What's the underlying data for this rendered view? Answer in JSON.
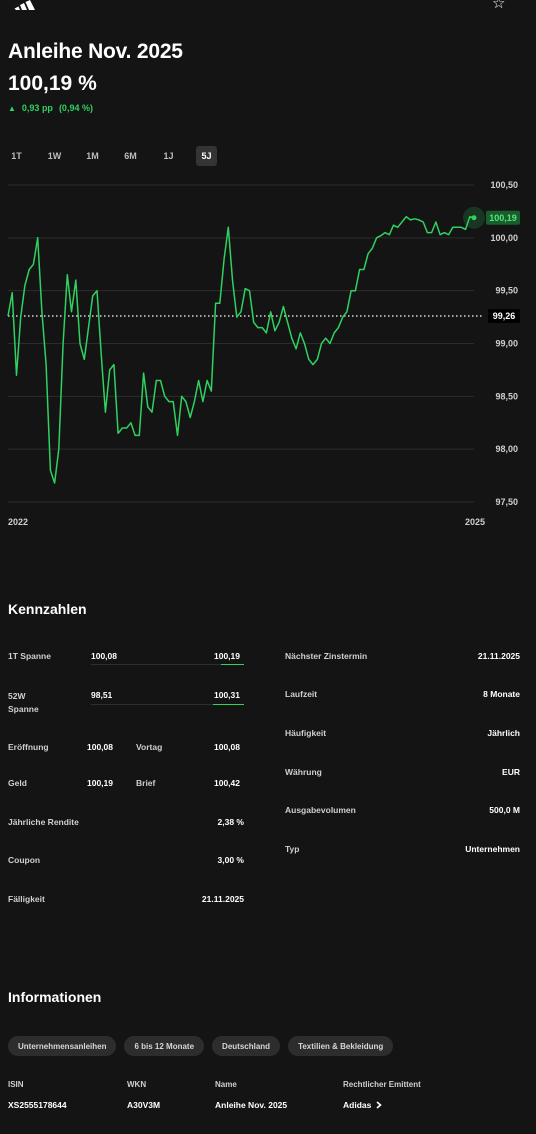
{
  "header": {
    "logo_icon": "adidas-logo-icon",
    "favorite_icon": "star-icon"
  },
  "bond": {
    "title": "Anleihe Nov. 2025",
    "price": "100,19 %",
    "change_abs": "0,93 pp",
    "change_pct": "(0,94 %)",
    "up_color": "#2fd160"
  },
  "ranges": [
    "1T",
    "1W",
    "1M",
    "6M",
    "1J",
    "5J"
  ],
  "active_range": "5J",
  "chart_data": {
    "type": "line",
    "x_start_label": "2022",
    "x_end_label": "2025",
    "y_ticks": [
      "100,50",
      "100,00",
      "99,50",
      "99,00",
      "98,50",
      "98,00",
      "97,50"
    ],
    "ylim": [
      97.5,
      100.5
    ],
    "reference_value": 99.26,
    "reference_label": "99,26",
    "last_label": "100,19",
    "line_color": "#2fd160",
    "values": [
      99.26,
      99.48,
      98.7,
      99.25,
      99.55,
      99.7,
      99.75,
      100.0,
      99.3,
      98.8,
      97.8,
      97.68,
      98.0,
      99.0,
      99.65,
      99.3,
      99.6,
      99.0,
      98.85,
      99.15,
      99.45,
      99.5,
      98.9,
      98.35,
      98.75,
      98.8,
      98.15,
      98.2,
      98.2,
      98.25,
      98.13,
      98.13,
      98.72,
      98.4,
      98.35,
      98.65,
      98.65,
      98.5,
      98.45,
      98.45,
      98.13,
      98.5,
      98.45,
      98.3,
      98.45,
      98.65,
      98.45,
      98.65,
      98.55,
      99.38,
      99.38,
      99.8,
      100.1,
      99.6,
      99.25,
      99.3,
      99.52,
      99.5,
      99.2,
      99.15,
      99.15,
      99.1,
      99.3,
      99.12,
      99.2,
      99.35,
      99.2,
      99.05,
      98.95,
      99.1,
      99.0,
      98.85,
      98.8,
      98.85,
      99.0,
      99.05,
      99.0,
      99.1,
      99.15,
      99.25,
      99.3,
      99.5,
      99.5,
      99.7,
      99.7,
      99.85,
      99.9,
      100.0,
      100.02,
      100.05,
      100.03,
      100.12,
      100.1,
      100.15,
      100.2,
      100.17,
      100.18,
      100.17,
      100.15,
      100.05,
      100.05,
      100.15,
      100.03,
      100.05,
      100.03,
      100.1,
      100.1,
      100.1,
      100.08,
      100.2,
      100.19
    ]
  },
  "kennzahlen": {
    "title": "Kennzahlen",
    "spanne_1t": {
      "label": "1T Spanne",
      "low": "100,08",
      "high": "100,19",
      "fill": 0.15
    },
    "spanne_52w": {
      "label_line1": "52W",
      "label_line2": "Spanne",
      "low": "98,51",
      "high": "100,31",
      "fill": 0.2
    },
    "eroeffnung": {
      "label": "Eröffnung",
      "value": "100,08"
    },
    "vortag": {
      "label": "Vortag",
      "value": "100,08"
    },
    "geld": {
      "label": "Geld",
      "value": "100,19"
    },
    "brief": {
      "label": "Brief",
      "value": "100,42"
    },
    "rendite": {
      "label": "Jährliche Rendite",
      "value": "2,38 %"
    },
    "coupon": {
      "label": "Coupon",
      "value": "3,00 %"
    },
    "faelligkeit": {
      "label": "Fälligkeit",
      "value": "21.11.2025"
    },
    "zinstermin": {
      "label": "Nächster Zinstermin",
      "value": "21.11.2025"
    },
    "laufzeit": {
      "label": "Laufzeit",
      "value": "8 Monate"
    },
    "haeufigkeit": {
      "label": "Häufigkeit",
      "value": "Jährlich"
    },
    "waehrung": {
      "label": "Währung",
      "value": "EUR"
    },
    "volumen": {
      "label": "Ausgabevolumen",
      "value": "500,0 M"
    },
    "typ": {
      "label": "Typ",
      "value": "Unternehmen"
    }
  },
  "informationen": {
    "title": "Informationen",
    "tags": [
      "Unternehmensanleihen",
      "6 bis 12 Monate",
      "Deutschland",
      "Textilien & Bekleidung"
    ],
    "isin": {
      "label": "ISIN",
      "value": "XS2555178644"
    },
    "wkn": {
      "label": "WKN",
      "value": "A30V3M"
    },
    "name": {
      "label": "Name",
      "value": "Anleihe Nov. 2025"
    },
    "emittent": {
      "label": "Rechtlicher Emittent",
      "value": "Adidas",
      "icon": "chevron-right-icon"
    }
  }
}
